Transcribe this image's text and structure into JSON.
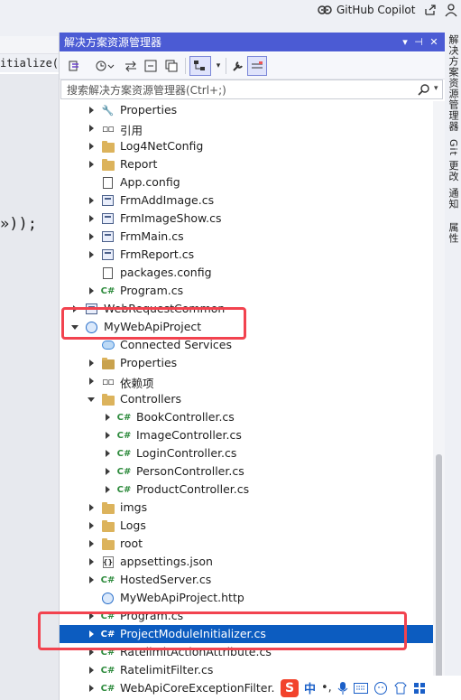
{
  "topbar": {
    "copilot_label": "GitHub Copilot"
  },
  "editor": {
    "line1": "itialize(ISer",
    "line2": "»));"
  },
  "panel": {
    "title": "解决方案资源管理器",
    "title_buttons": [
      "▾",
      "⊣",
      "✕"
    ],
    "search_placeholder": "搜索解决方案资源管理器(Ctrl+;)"
  },
  "tree": [
    {
      "label": "Properties",
      "icon": "wrench-icon",
      "indent": 1,
      "arrow": "right"
    },
    {
      "label": "引用",
      "icon": "references-icon",
      "indent": 1,
      "arrow": "right"
    },
    {
      "label": "Log4NetConfig",
      "icon": "folder-icon",
      "indent": 1,
      "arrow": "right"
    },
    {
      "label": "Report",
      "icon": "folder-icon",
      "indent": 1,
      "arrow": "right"
    },
    {
      "label": "App.config",
      "icon": "config-icon",
      "indent": 1,
      "arrow": "none"
    },
    {
      "label": "FrmAddImage.cs",
      "icon": "form-icon",
      "indent": 1,
      "arrow": "right"
    },
    {
      "label": "FrmImageShow.cs",
      "icon": "form-icon",
      "indent": 1,
      "arrow": "right"
    },
    {
      "label": "FrmMain.cs",
      "icon": "form-icon",
      "indent": 1,
      "arrow": "right"
    },
    {
      "label": "FrmReport.cs",
      "icon": "form-icon",
      "indent": 1,
      "arrow": "right"
    },
    {
      "label": "packages.config",
      "icon": "config-icon",
      "indent": 1,
      "arrow": "none"
    },
    {
      "label": "Program.cs",
      "icon": "csharp-icon",
      "indent": 1,
      "arrow": "right"
    },
    {
      "label": "WebRequestCommon",
      "icon": "project-icon",
      "indent": 0,
      "arrow": "right"
    },
    {
      "label": "MyWebApiProject",
      "icon": "web-project-icon",
      "indent": 0,
      "arrow": "down"
    },
    {
      "label": "Connected Services",
      "icon": "cloud-icon",
      "indent": 1,
      "arrow": "none"
    },
    {
      "label": "Properties",
      "icon": "properties-folder-icon",
      "indent": 1,
      "arrow": "right"
    },
    {
      "label": "依赖项",
      "icon": "references-icon",
      "indent": 1,
      "arrow": "right"
    },
    {
      "label": "Controllers",
      "icon": "folder-icon",
      "indent": 1,
      "arrow": "down"
    },
    {
      "label": "BookController.cs",
      "icon": "csharp-icon",
      "indent": 2,
      "arrow": "right"
    },
    {
      "label": "ImageController.cs",
      "icon": "csharp-icon",
      "indent": 2,
      "arrow": "right"
    },
    {
      "label": "LoginController.cs",
      "icon": "csharp-icon",
      "indent": 2,
      "arrow": "right"
    },
    {
      "label": "PersonController.cs",
      "icon": "csharp-icon",
      "indent": 2,
      "arrow": "right"
    },
    {
      "label": "ProductController.cs",
      "icon": "csharp-icon",
      "indent": 2,
      "arrow": "right"
    },
    {
      "label": "imgs",
      "icon": "folder-icon",
      "indent": 1,
      "arrow": "right"
    },
    {
      "label": "Logs",
      "icon": "folder-icon",
      "indent": 1,
      "arrow": "right"
    },
    {
      "label": "root",
      "icon": "folder-icon",
      "indent": 1,
      "arrow": "right"
    },
    {
      "label": "appsettings.json",
      "icon": "json-icon",
      "indent": 1,
      "arrow": "right"
    },
    {
      "label": "HostedServer.cs",
      "icon": "csharp-icon",
      "indent": 1,
      "arrow": "right"
    },
    {
      "label": "MyWebApiProject.http",
      "icon": "http-icon",
      "indent": 1,
      "arrow": "none"
    },
    {
      "label": "Program.cs",
      "icon": "csharp-icon",
      "indent": 1,
      "arrow": "right"
    },
    {
      "label": "ProjectModuleInitializer.cs",
      "icon": "csharp-icon",
      "indent": 1,
      "arrow": "right",
      "selected": true
    },
    {
      "label": "RatelimitActionAttribute.cs",
      "icon": "csharp-icon",
      "indent": 1,
      "arrow": "right"
    },
    {
      "label": "RatelimitFilter.cs",
      "icon": "csharp-icon",
      "indent": 1,
      "arrow": "right"
    },
    {
      "label": "WebApiCoreExceptionFilter.cs",
      "icon": "csharp-icon",
      "indent": 1,
      "arrow": "right"
    }
  ],
  "right_tabs": [
    "解决方案资源管理器",
    "Git 更改",
    "通知",
    "属性"
  ],
  "ime": {
    "logo": "S",
    "mode": "中",
    "punct": "•,",
    "dot": "·"
  },
  "colors": {
    "title_bar": "#4b5bd4",
    "selection": "#0c5cc0",
    "highlight": "#f2434f"
  }
}
